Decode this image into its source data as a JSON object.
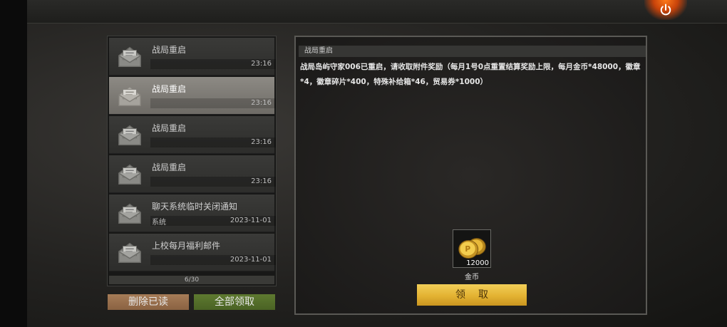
{
  "mail_list": {
    "items": [
      {
        "title": "战局重启",
        "sender": "",
        "time": "23:16"
      },
      {
        "title": "战局重启",
        "sender": "",
        "time": "23:16"
      },
      {
        "title": "战局重启",
        "sender": "",
        "time": "23:16"
      },
      {
        "title": "战局重启",
        "sender": "",
        "time": "23:16"
      },
      {
        "title": "聊天系统临时关闭通知",
        "sender": "系统",
        "time": "2023-11-01"
      },
      {
        "title": "上校每月福利邮件",
        "sender": "",
        "time": "2023-11-01"
      }
    ],
    "selected_index": 1,
    "pagination": "6/30"
  },
  "buttons": {
    "delete_read": "删除已读",
    "claim_all": "全部领取",
    "claim": "领取"
  },
  "detail": {
    "title": "战局重启",
    "body": "战局岛屿守家006已重启，请收取附件奖励（每月1号0点重置结算奖励上限，每月金币*48000，徽章*4，徽章碎片*400，特殊补给箱*46，贸易券*1000）",
    "reward": {
      "name": "金币",
      "quantity": "12000",
      "icon": "gold-coins-icon"
    }
  },
  "icons": {
    "power": "power-icon",
    "mail": "open-envelope-icon"
  },
  "colors": {
    "accent_gold": "#e3b232",
    "power_glow": "#ff7a1a",
    "selected_item": "#8d8a84"
  }
}
